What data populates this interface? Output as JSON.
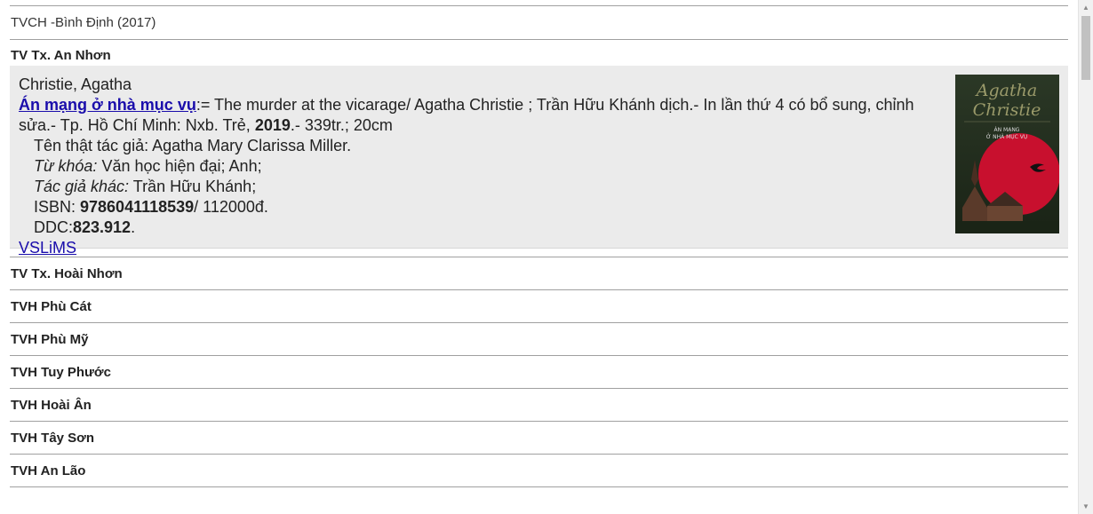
{
  "header": {
    "title": "TVCH -Bình Định (2017)"
  },
  "libraries": {
    "first": "TV Tx. An Nhơn",
    "rest": [
      "TV Tx. Hoài Nhơn",
      "TVH Phù Cát",
      "TVH Phù Mỹ",
      "TVH Tuy Phước",
      "TVH Hoài Ân",
      "TVH Tây Sơn",
      "TVH An Lão"
    ]
  },
  "record": {
    "author": "Christie, Agatha",
    "title_link": "Án mạng ở nhà mục vụ",
    "title_rest": ":= The murder at the vicarage/ Agatha Christie ; Trần Hữu Khánh dịch.- In lần thứ 4 có bổ sung, chỉnh sửa.- Tp. Hồ Chí Minh: Nxb. Trẻ, ",
    "year": "2019",
    "pages": ".- 339tr.; 20cm",
    "real_name": "Tên thật tác giả: Agatha Mary Clarissa Miller.",
    "keywords_label": "Từ khóa:",
    "keywords_value": " Văn học hiện đại; Anh;",
    "other_authors_label": "Tác giả khác:",
    "other_authors_value": " Trần Hữu Khánh;",
    "isbn_label": "ISBN: ",
    "isbn_value": "9786041118539",
    "price": "/ 112000đ.",
    "ddc_label": "DDC:",
    "ddc_value": "823.912",
    "ddc_end": ".",
    "vslims_link": "VSLiMS",
    "cover": {
      "author_text": "Agatha Christie",
      "title_text": "ÁN MẠNG Ở NHÀ MỤC VỤ",
      "accent_color": "#c8102e",
      "background_color": "#1f2a1c"
    }
  },
  "colors": {
    "link": "#1a0dab",
    "record_bg": "#ebebeb",
    "rule": "#a0a0a0"
  }
}
